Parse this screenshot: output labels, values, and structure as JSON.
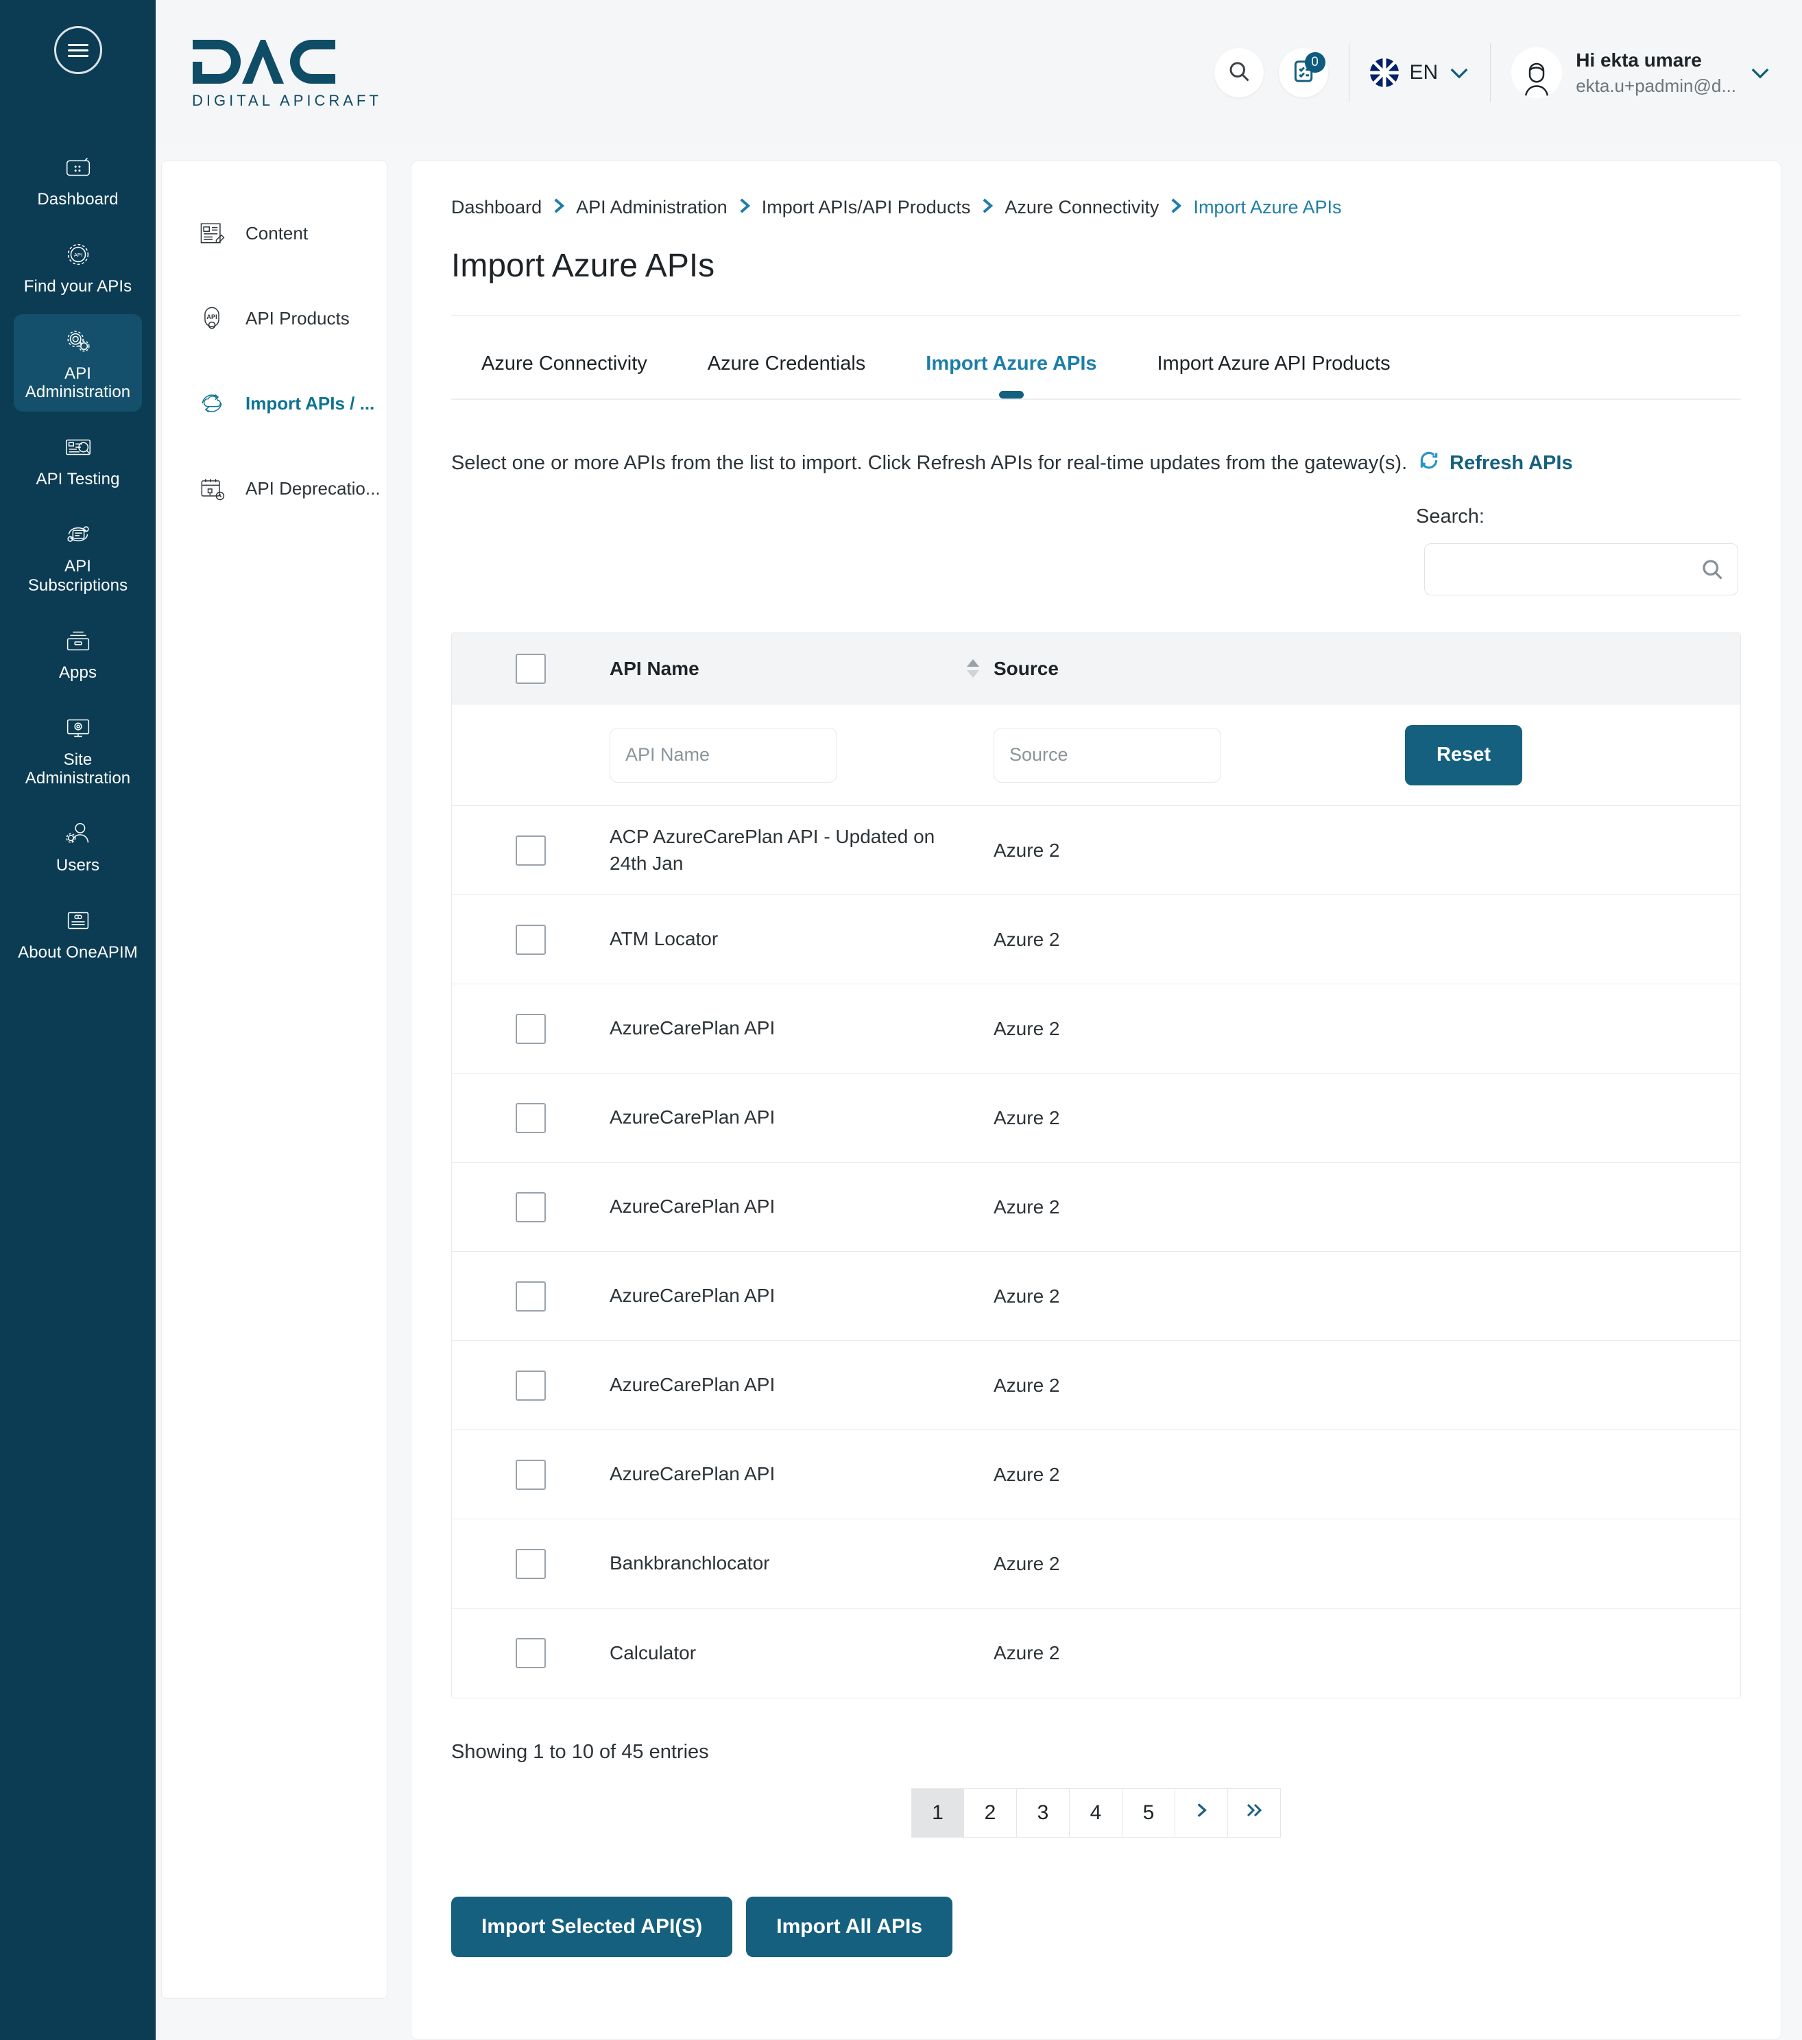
{
  "brand": {
    "logo_text": "DAC",
    "logo_sub": "DIGITAL APICRAFT"
  },
  "header": {
    "notification_count": "0",
    "language": "EN",
    "user_greeting": "Hi ekta umare",
    "user_email": "ekta.u+padmin@d..."
  },
  "rail": {
    "items": [
      {
        "label": "Dashboard",
        "icon": "dashboard-icon",
        "active": false
      },
      {
        "label": "Find your APIs",
        "icon": "find-apis-icon",
        "active": false
      },
      {
        "label": "API Administration",
        "icon": "api-administration-icon",
        "active": true
      },
      {
        "label": "API Testing",
        "icon": "api-testing-icon",
        "active": false
      },
      {
        "label": "API Subscriptions",
        "icon": "api-subscriptions-icon",
        "active": false
      },
      {
        "label": "Apps",
        "icon": "apps-icon",
        "active": false
      },
      {
        "label": "Site Administration",
        "icon": "site-administration-icon",
        "active": false
      },
      {
        "label": "Users",
        "icon": "users-icon",
        "active": false
      },
      {
        "label": "About OneAPIM",
        "icon": "about-oneapim-icon",
        "active": false
      }
    ]
  },
  "subnav": {
    "items": [
      {
        "label": "Content",
        "icon": "content-icon",
        "active": false
      },
      {
        "label": "API Products",
        "icon": "api-products-icon",
        "active": false
      },
      {
        "label": "Import APIs / ...",
        "icon": "import-apis-icon",
        "active": true
      },
      {
        "label": "API Deprecatio...",
        "icon": "api-deprecation-icon",
        "active": false
      }
    ]
  },
  "breadcrumb": [
    {
      "label": "Dashboard",
      "current": false
    },
    {
      "label": "API Administration",
      "current": false
    },
    {
      "label": "Import APIs/API Products",
      "current": false
    },
    {
      "label": "Azure Connectivity",
      "current": false
    },
    {
      "label": "Import Azure APIs",
      "current": true
    }
  ],
  "page": {
    "title": "Import Azure APIs"
  },
  "tabs": [
    {
      "label": "Azure Connectivity",
      "active": false
    },
    {
      "label": "Azure Credentials",
      "active": false
    },
    {
      "label": "Import Azure APIs",
      "active": true
    },
    {
      "label": "Import Azure API Products",
      "active": false
    }
  ],
  "instructions": {
    "text": "Select one or more APIs from the list to import. Click Refresh APIs for real-time updates from the gateway(s).",
    "refresh_label": "Refresh APIs"
  },
  "search": {
    "label": "Search:",
    "value": "",
    "placeholder": ""
  },
  "table": {
    "columns": [
      "API Name",
      "Source"
    ],
    "filters": {
      "name_placeholder": "API Name",
      "name_value": "",
      "source_placeholder": "Source",
      "source_value": ""
    },
    "reset_label": "Reset",
    "rows": [
      {
        "name": "ACP AzureCarePlan API - Updated on 24th Jan",
        "source": "Azure 2",
        "checked": false
      },
      {
        "name": "ATM Locator",
        "source": "Azure 2",
        "checked": false
      },
      {
        "name": "AzureCarePlan API",
        "source": "Azure 2",
        "checked": false
      },
      {
        "name": "AzureCarePlan API",
        "source": "Azure 2",
        "checked": false
      },
      {
        "name": "AzureCarePlan API",
        "source": "Azure 2",
        "checked": false
      },
      {
        "name": "AzureCarePlan API",
        "source": "Azure 2",
        "checked": false
      },
      {
        "name": "AzureCarePlan API",
        "source": "Azure 2",
        "checked": false
      },
      {
        "name": "AzureCarePlan API",
        "source": "Azure 2",
        "checked": false
      },
      {
        "name": "Bankbranchlocator",
        "source": "Azure 2",
        "checked": false
      },
      {
        "name": "Calculator",
        "source": "Azure 2",
        "checked": false
      }
    ]
  },
  "footer": {
    "showing": "Showing 1 to 10 of 45 entries",
    "pages": [
      "1",
      "2",
      "3",
      "4",
      "5"
    ],
    "active_page": "1",
    "import_selected_label": "Import Selected API(S)",
    "import_all_label": "Import All APIs"
  },
  "colors": {
    "brand": "#0b3c53",
    "accent": "#15607f",
    "link": "#1d7ea8",
    "active_rail": "#14506b"
  }
}
